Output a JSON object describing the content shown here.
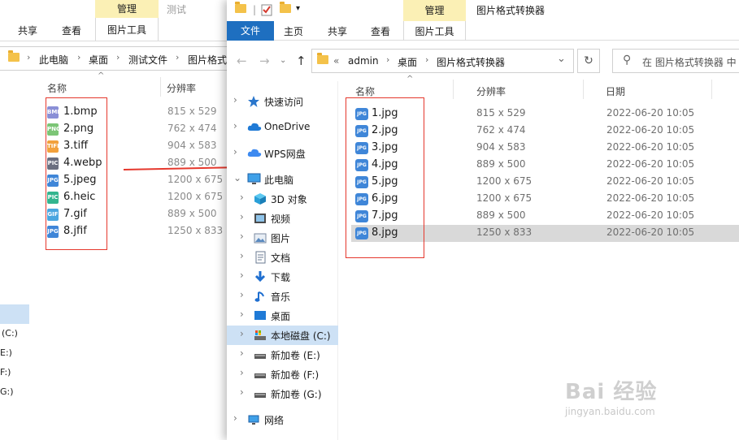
{
  "back_window": {
    "ctx_header": "管理",
    "ctx_other": "测试",
    "tabs": [
      "共享",
      "查看"
    ],
    "ctx_tab": "图片工具",
    "breadcrumbs": [
      "此电脑",
      "桌面",
      "测试文件",
      "图片格式"
    ],
    "col_name": "名称",
    "col_resolution": "分辨率",
    "files": [
      {
        "name": "1.bmp",
        "res": "815 x 529",
        "badge": "BMP",
        "color": "#8a8fd6"
      },
      {
        "name": "2.png",
        "res": "762 x 474",
        "badge": "PNG",
        "color": "#7cc576"
      },
      {
        "name": "3.tiff",
        "res": "904 x 583",
        "badge": "TIFF",
        "color": "#f2a13c"
      },
      {
        "name": "4.webp",
        "res": "889 x 500",
        "badge": "PIC",
        "color": "#6b6f80"
      },
      {
        "name": "5.jpeg",
        "res": "1200 x 675",
        "badge": "JPG",
        "color": "#3f86d8"
      },
      {
        "name": "6.heic",
        "res": "1200 x 675",
        "badge": "PIC",
        "color": "#33b58f"
      },
      {
        "name": "7.gif",
        "res": "889 x 500",
        "badge": "GIF",
        "color": "#4aa6e0"
      },
      {
        "name": "8.jfif",
        "res": "1250 x 833",
        "badge": "JPG",
        "color": "#3f86d8"
      }
    ],
    "drives": [
      "(C:)",
      "E:)",
      "F:)",
      "G:)"
    ]
  },
  "front_window": {
    "title": "图片格式转换器",
    "ctx_header": "管理",
    "ribbon_tabs": {
      "file": "文件",
      "home": "主页",
      "share": "共享",
      "view": "查看",
      "ctx": "图片工具"
    },
    "breadcrumbs": {
      "prefix": "«",
      "items": [
        "admin",
        "桌面",
        "图片格式转换器"
      ]
    },
    "search_placeholder": "在 图片格式转换器 中",
    "nav": [
      {
        "label": "快速访问",
        "icon": "star-icon",
        "depth": 0
      },
      {
        "label": "OneDrive",
        "icon": "cloud-icon",
        "depth": 0
      },
      {
        "label": "WPS网盘",
        "icon": "wps-cloud-icon",
        "depth": 0
      },
      {
        "label": "此电脑",
        "icon": "computer-icon",
        "depth": 0,
        "expanded": true
      },
      {
        "label": "3D 对象",
        "icon": "cube-icon",
        "depth": 1
      },
      {
        "label": "视频",
        "icon": "video-icon",
        "depth": 1
      },
      {
        "label": "图片",
        "icon": "picture-icon",
        "depth": 1
      },
      {
        "label": "文档",
        "icon": "document-icon",
        "depth": 1
      },
      {
        "label": "下载",
        "icon": "download-icon",
        "depth": 1
      },
      {
        "label": "音乐",
        "icon": "music-icon",
        "depth": 1
      },
      {
        "label": "桌面",
        "icon": "desktop-icon",
        "depth": 1
      },
      {
        "label": "本地磁盘 (C:)",
        "icon": "local-disk-icon",
        "depth": 1,
        "selected": true
      },
      {
        "label": "新加卷 (E:)",
        "icon": "drive-icon",
        "depth": 1
      },
      {
        "label": "新加卷 (F:)",
        "icon": "drive-icon",
        "depth": 1
      },
      {
        "label": "新加卷 (G:)",
        "icon": "drive-icon",
        "depth": 1
      },
      {
        "label": "网络",
        "icon": "network-icon",
        "depth": 0
      }
    ],
    "columns": {
      "name": "名称",
      "resolution": "分辨率",
      "date": "日期"
    },
    "files": [
      {
        "name": "1.jpg",
        "res": "815 x 529",
        "date": "2022-06-20 10:05"
      },
      {
        "name": "2.jpg",
        "res": "762 x 474",
        "date": "2022-06-20 10:05"
      },
      {
        "name": "3.jpg",
        "res": "904 x 583",
        "date": "2022-06-20 10:05"
      },
      {
        "name": "4.jpg",
        "res": "889 x 500",
        "date": "2022-06-20 10:05"
      },
      {
        "name": "5.jpg",
        "res": "1200 x 675",
        "date": "2022-06-20 10:05"
      },
      {
        "name": "6.jpg",
        "res": "1200 x 675",
        "date": "2022-06-20 10:05"
      },
      {
        "name": "7.jpg",
        "res": "889 x 500",
        "date": "2022-06-20 10:05"
      },
      {
        "name": "8.jpg",
        "res": "1250 x 833",
        "date": "2022-06-20 10:05",
        "selected": true
      }
    ]
  },
  "watermark": {
    "brand": "Bai 经验",
    "url": "jingyan.baidu.com"
  },
  "colors": {
    "accent": "#1e6fc0",
    "context_tab": "#fbf0b5",
    "highlight_box": "#e5382d",
    "arrow": "#e5382d",
    "selection": "#cde1f5"
  }
}
